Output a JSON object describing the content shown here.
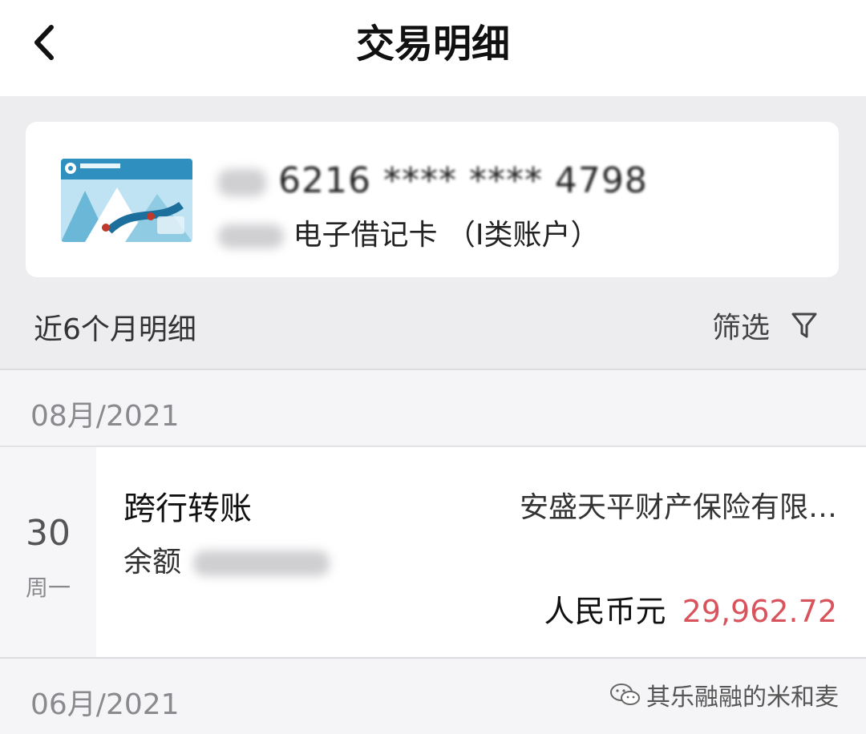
{
  "header": {
    "title": "交易明细"
  },
  "card": {
    "number_masked": "6216 **** **** 4798",
    "type_label": "电子借记卡 （I类账户）"
  },
  "list_header": {
    "period_label": "近6个月明细",
    "filter_label": "筛选"
  },
  "sections": [
    {
      "month": "08月/2021",
      "transactions": [
        {
          "day": "30",
          "weekday": "周一",
          "type": "跨行转账",
          "counterparty": "安盛天平财产保险有限…",
          "balance_label": "余额",
          "currency": "人民币元",
          "amount": "29,962.72"
        }
      ]
    },
    {
      "month": "06月/2021"
    }
  ],
  "watermark": {
    "text": "其乐融融的米和麦"
  },
  "colors": {
    "amount": "#d9535c",
    "background": "#ededf0",
    "card": "#ffffff"
  }
}
